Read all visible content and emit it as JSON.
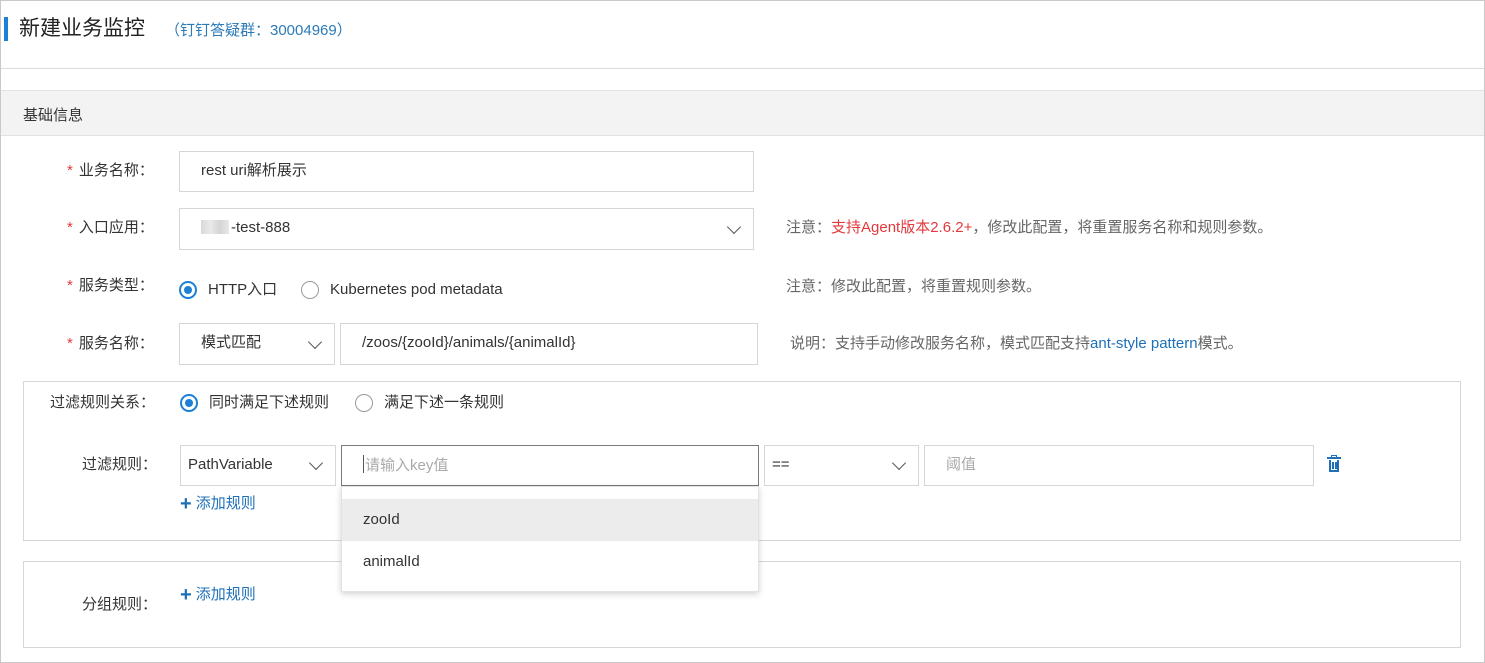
{
  "header": {
    "title": "新建业务监控",
    "subtitle": "（钉钉答疑群：30004969）"
  },
  "section": {
    "title": "基础信息"
  },
  "form": {
    "business_name": {
      "label": "业务名称：",
      "value": "rest uri解析展示"
    },
    "entry_app": {
      "label": "入口应用：",
      "value": "-test-888",
      "note_prefix": "注意：",
      "note_highlight": "支持Agent版本2.6.2+",
      "note_suffix": "，修改此配置，将重置服务名称和规则参数。"
    },
    "service_type": {
      "label": "服务类型：",
      "options": [
        "HTTP入口",
        "Kubernetes pod metadata"
      ],
      "selected": "HTTP入口",
      "note": "注意：修改此配置，将重置规则参数。"
    },
    "service_name": {
      "label": "服务名称：",
      "mode": "模式匹配",
      "value": "/zoos/{zooId}/animals/{animalId}",
      "note_prefix": "说明：支持手动修改服务名称，模式匹配支持",
      "note_link": "ant-style pattern",
      "note_suffix": "模式。"
    }
  },
  "filter": {
    "relation_label": "过滤规则关系：",
    "relation_options": [
      "同时满足下述规则",
      "满足下述一条规则"
    ],
    "relation_selected": "同时满足下述规则",
    "rule_label": "过滤规则：",
    "rule_type": "PathVariable",
    "key_placeholder": "请输入key值",
    "operator": "==",
    "threshold_placeholder": "阈值",
    "add_rule": "添加规则",
    "key_options": [
      "zooId",
      "animalId"
    ],
    "key_hovered": "zooId"
  },
  "group": {
    "label": "分组规则：",
    "add_rule": "添加规则"
  },
  "colors": {
    "accent": "#1d7fd6",
    "link": "#1d70b8",
    "required": "#e3393c"
  }
}
